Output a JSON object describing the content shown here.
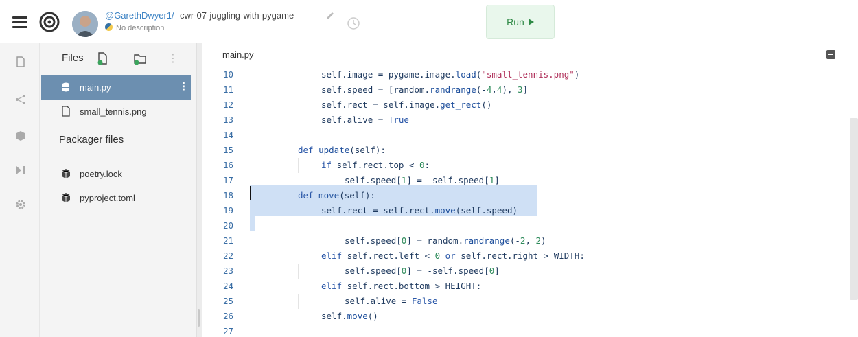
{
  "header": {
    "repl_user": "@GarethDwyer1/",
    "repl_name": "cwr-07-juggling-with-pygame",
    "description": "No description",
    "run_label": "Run"
  },
  "files_panel": {
    "title": "Files",
    "files": [
      {
        "name": "main.py",
        "active": true,
        "icon": "python-file-icon"
      },
      {
        "name": "small_tennis.png",
        "active": false,
        "icon": "file-icon"
      }
    ],
    "packager_title": "Packager files",
    "packager_files": [
      {
        "name": "poetry.lock",
        "icon": "package-icon"
      },
      {
        "name": "pyproject.toml",
        "icon": "package-icon"
      }
    ]
  },
  "editor": {
    "tab": "main.py",
    "lines": [
      {
        "n": "10",
        "code": "self.image = pygame.image.load(\"small_tennis.png\")"
      },
      {
        "n": "11",
        "code": "self.speed = [random.randrange(-4,4), 3]"
      },
      {
        "n": "12",
        "code": "self.rect = self.image.get_rect()"
      },
      {
        "n": "13",
        "code": "self.alive = True"
      },
      {
        "n": "14",
        "code": ""
      },
      {
        "n": "15",
        "code": "def update(self):"
      },
      {
        "n": "16",
        "code": "if self.rect.top < 0:"
      },
      {
        "n": "17",
        "code": "self.speed[1] = -self.speed[1]"
      },
      {
        "n": "18",
        "code": "def move(self):"
      },
      {
        "n": "19",
        "code": "self.rect = self.rect.move(self.speed)"
      },
      {
        "n": "20",
        "code": ""
      },
      {
        "n": "21",
        "code": "self.speed[0] = random.randrange(-2, 2)"
      },
      {
        "n": "22",
        "code": "elif self.rect.left < 0 or self.rect.right > WIDTH:"
      },
      {
        "n": "23",
        "code": "self.speed[0] = -self.speed[0]"
      },
      {
        "n": "24",
        "code": "elif self.rect.bottom > HEIGHT:"
      },
      {
        "n": "25",
        "code": "self.alive = False"
      },
      {
        "n": "26",
        "code": "self.move()"
      },
      {
        "n": "27",
        "code": ""
      }
    ]
  },
  "colors": {
    "accent_blue": "#3b82c4",
    "active_file_bg": "#6c8fb0",
    "run_green": "#2f8a46",
    "selection": "#cfe0f5"
  }
}
